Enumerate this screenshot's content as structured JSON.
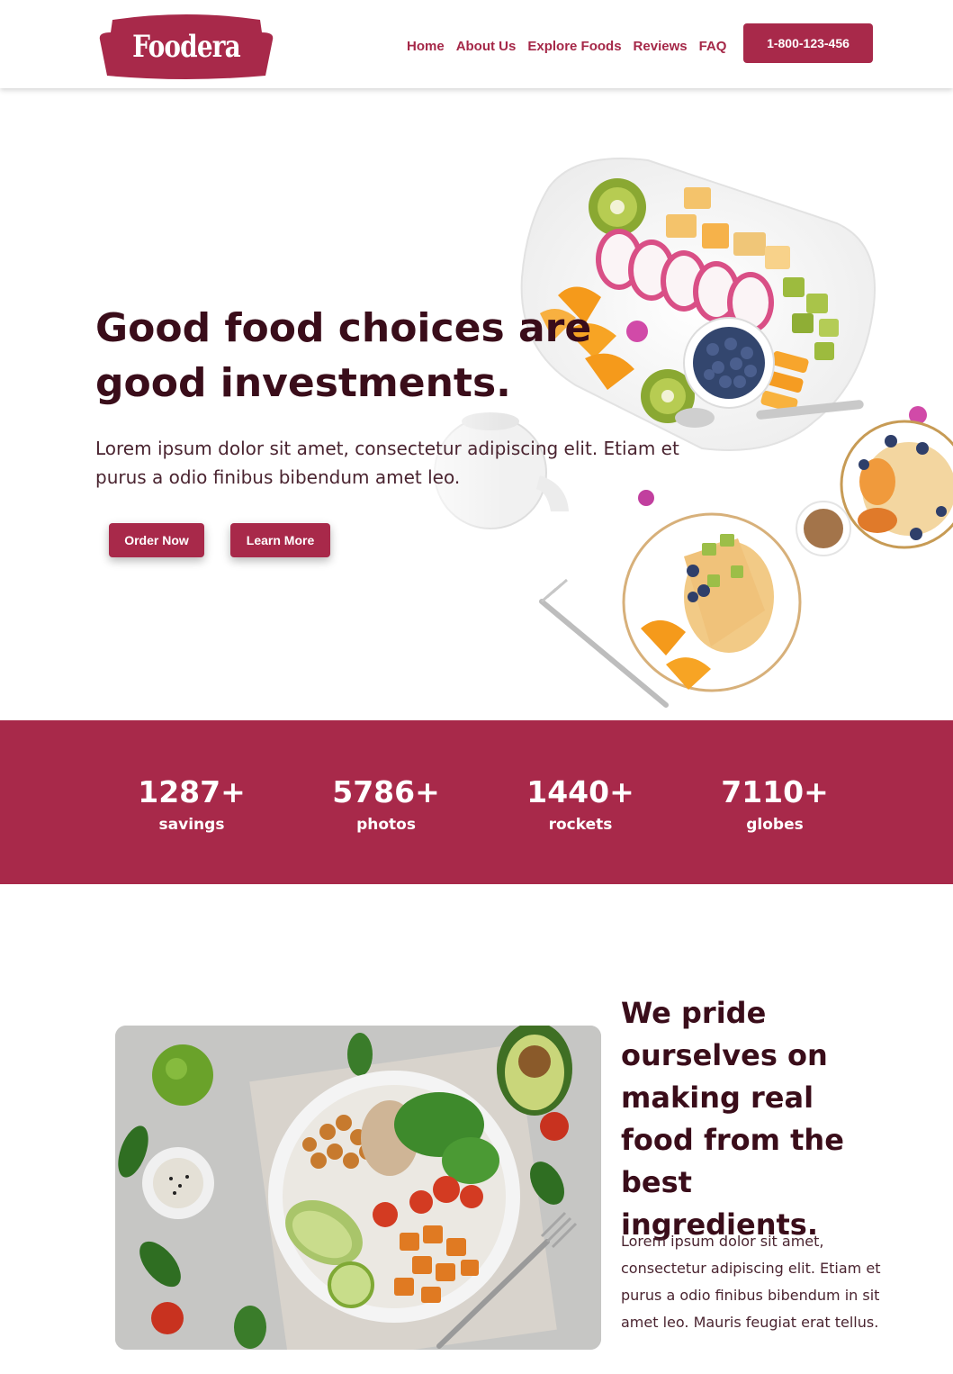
{
  "header": {
    "logo_text": "Foodera",
    "nav": [
      "Home",
      "About Us",
      "Explore Foods",
      "Reviews",
      "FAQ"
    ],
    "phone": "1-800-123-456"
  },
  "hero": {
    "title": "Good food choices are good investments.",
    "text": "Lorem ipsum dolor sit amet, consectetur adipiscing elit. Etiam et purus a odio finibus bibendum amet leo.",
    "order_label": "Order Now",
    "learn_label": "Learn More"
  },
  "stats": [
    {
      "value": "1287+",
      "label": "savings"
    },
    {
      "value": "5786+",
      "label": "photos"
    },
    {
      "value": "1440+",
      "label": "rockets"
    },
    {
      "value": "7110+",
      "label": "globes"
    }
  ],
  "pride": {
    "title": "We pride ourselves on making real food from the best ingredients.",
    "text": "Lorem ipsum dolor sit amet, consectetur adipiscing elit. Etiam et purus a odio finibus bibendum in sit amet leo. Mauris feugiat erat tellus."
  },
  "colors": {
    "brand": "#a8294a",
    "heading": "#3a0d1a",
    "background": "#ffffff"
  }
}
